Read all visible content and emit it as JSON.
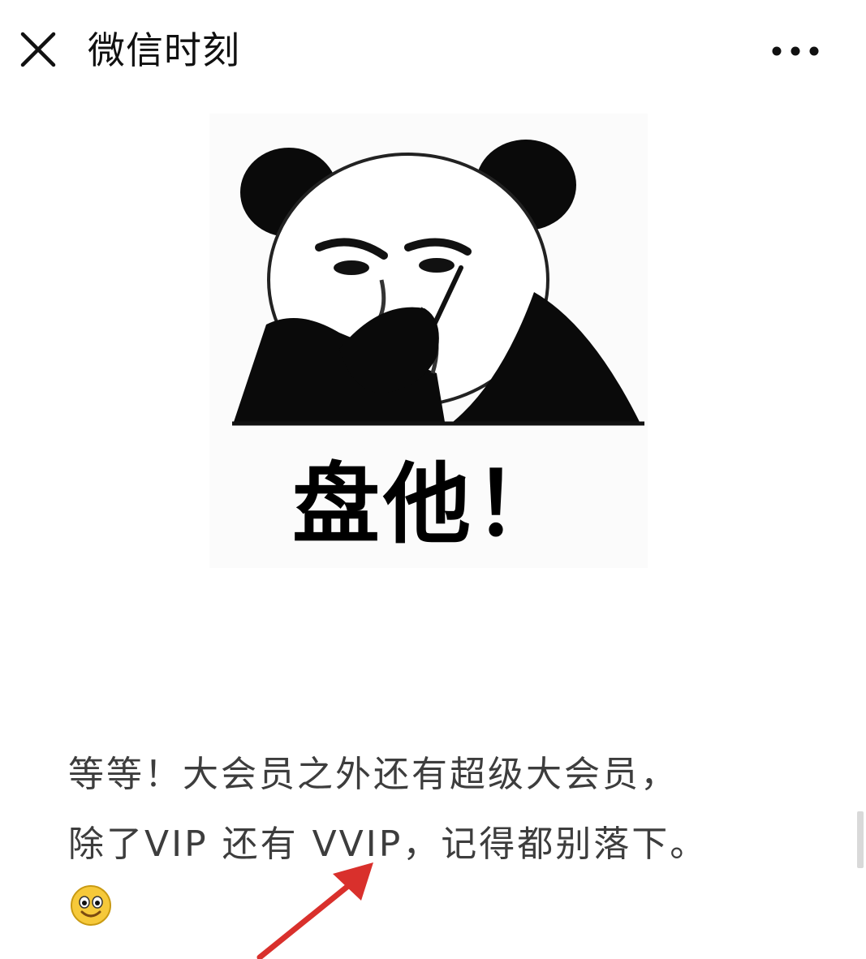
{
  "header": {
    "title": "微信时刻",
    "close_icon": "close-icon",
    "more_icon": "more-dots-icon"
  },
  "meme": {
    "caption": "盘他！"
  },
  "article": {
    "lines": [
      "等等！大会员之外还有超级大会员，",
      "除了VIP 还有 VVIP，记得都别落下。"
    ],
    "emoji_icon": "smile-emoji-icon"
  },
  "annotation": {
    "arrow_color": "#d9302c",
    "arrow_icon": "red-arrow-icon"
  }
}
